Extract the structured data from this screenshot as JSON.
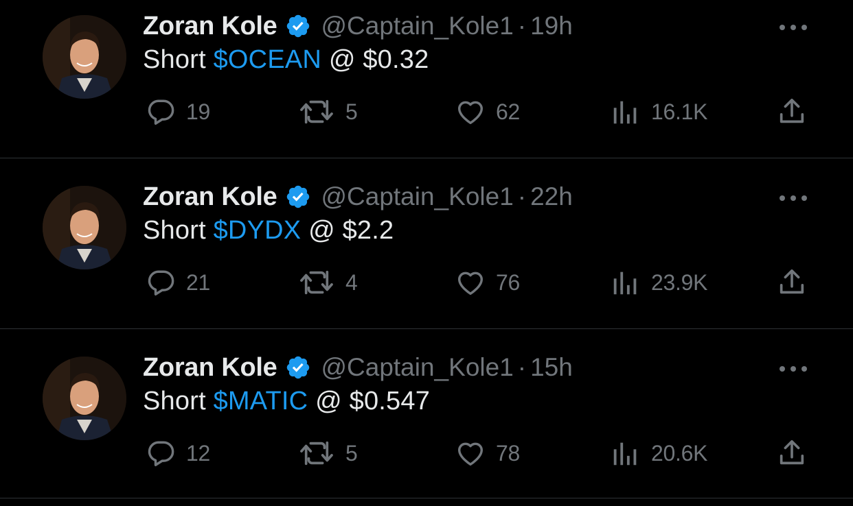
{
  "tweets": [
    {
      "author_name": "Zoran Kole",
      "handle": "@Captain_Kole1",
      "separator": "·",
      "time": "19h",
      "text_prefix": "Short ",
      "cashtag": "$OCEAN",
      "text_suffix": " @ $0.32",
      "replies": "19",
      "retweets": "5",
      "likes": "62",
      "views": "16.1K"
    },
    {
      "author_name": "Zoran Kole",
      "handle": "@Captain_Kole1",
      "separator": "·",
      "time": "22h",
      "text_prefix": "Short ",
      "cashtag": "$DYDX",
      "text_suffix": " @ $2.2",
      "replies": "21",
      "retweets": "4",
      "likes": "76",
      "views": "23.9K"
    },
    {
      "author_name": "Zoran Kole",
      "handle": "@Captain_Kole1",
      "separator": "·",
      "time": "15h",
      "text_prefix": "Short ",
      "cashtag": "$MATIC",
      "text_suffix": " @ $0.547",
      "replies": "12",
      "retweets": "5",
      "likes": "78",
      "views": "20.6K"
    }
  ],
  "icons": {
    "verified": "verified-badge-icon",
    "more": "more-options-icon",
    "reply": "reply-icon",
    "retweet": "retweet-icon",
    "like": "heart-icon",
    "views": "views-icon",
    "share": "share-icon"
  },
  "colors": {
    "background": "#000000",
    "primary_text": "#e7e9ea",
    "secondary_text": "#71767b",
    "accent": "#1d9bf0",
    "divider": "#2f3336"
  }
}
